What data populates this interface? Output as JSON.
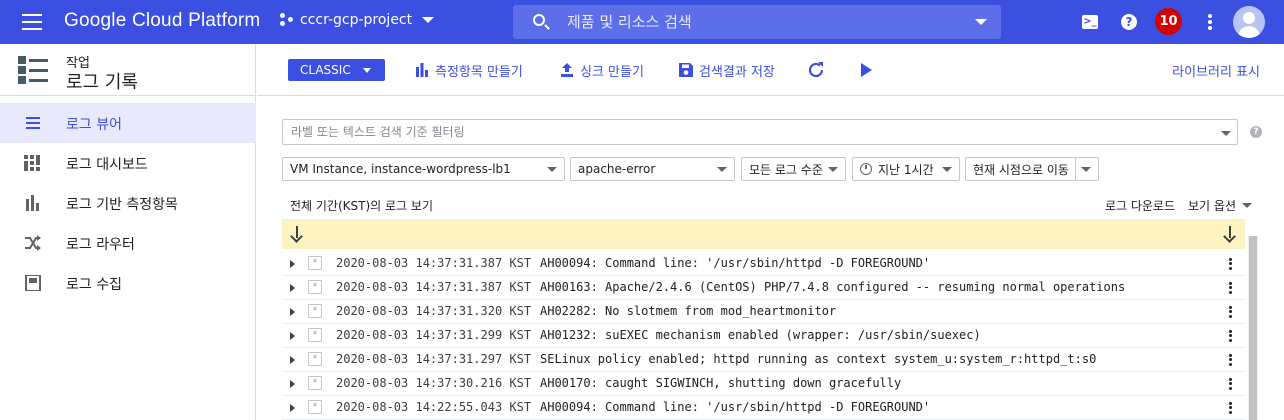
{
  "topbar": {
    "brand": "Google Cloud Platform",
    "project": "cccr-gcp-project",
    "search_placeholder": "제품 및 리소스 검색",
    "notifications": "10",
    "color": "#3b4fe0"
  },
  "sidebar": {
    "subtitle": "작업",
    "title": "로그 기록",
    "items": [
      {
        "label": "로그 뷰어",
        "icon": "list-icon",
        "active": true
      },
      {
        "label": "로그 대시보드",
        "icon": "dashboard-icon"
      },
      {
        "label": "로그 기반 측정항목",
        "icon": "bar-chart-icon"
      },
      {
        "label": "로그 라우터",
        "icon": "shuffle-icon"
      },
      {
        "label": "로그 수집",
        "icon": "storage-icon"
      }
    ]
  },
  "toolbar": {
    "classic": "CLASSIC",
    "create_metric": "측정항목 만들기",
    "create_sink": "싱크 만들기",
    "save_search": "검색결과 저장",
    "library": "라이브러리 표시"
  },
  "filter": {
    "placeholder": "라벨 또는 텍스트 검색 기준 필터링",
    "resource": "VM Instance, instance-wordpress-lb1",
    "log_name": "apache-error",
    "level": "모든 로그 수준",
    "time": "지난 1시간",
    "jump": "현재 시점으로 이동"
  },
  "logbar": {
    "title": "전체 기간(KST)의 로그 보기",
    "download": "로그 다운로드",
    "view_options": "보기 옵션"
  },
  "logs": [
    {
      "ts": "2020-08-03 14:37:31.387 KST",
      "msg": "AH00094: Command line: '/usr/sbin/httpd -D FOREGROUND'"
    },
    {
      "ts": "2020-08-03 14:37:31.387 KST",
      "msg": "AH00163: Apache/2.4.6 (CentOS) PHP/7.4.8 configured -- resuming normal operations"
    },
    {
      "ts": "2020-08-03 14:37:31.320 KST",
      "msg": "AH02282: No slotmem from mod_heartmonitor"
    },
    {
      "ts": "2020-08-03 14:37:31.299 KST",
      "msg": "AH01232: suEXEC mechanism enabled (wrapper: /usr/sbin/suexec)"
    },
    {
      "ts": "2020-08-03 14:37:31.297 KST",
      "msg": "SELinux policy enabled; httpd running as context system_u:system_r:httpd_t:s0"
    },
    {
      "ts": "2020-08-03 14:37:30.216 KST",
      "msg": "AH00170: caught SIGWINCH, shutting down gracefully"
    },
    {
      "ts": "2020-08-03 14:22:55.043 KST",
      "msg": "AH00094: Command line: '/usr/sbin/httpd -D FOREGROUND'"
    }
  ]
}
